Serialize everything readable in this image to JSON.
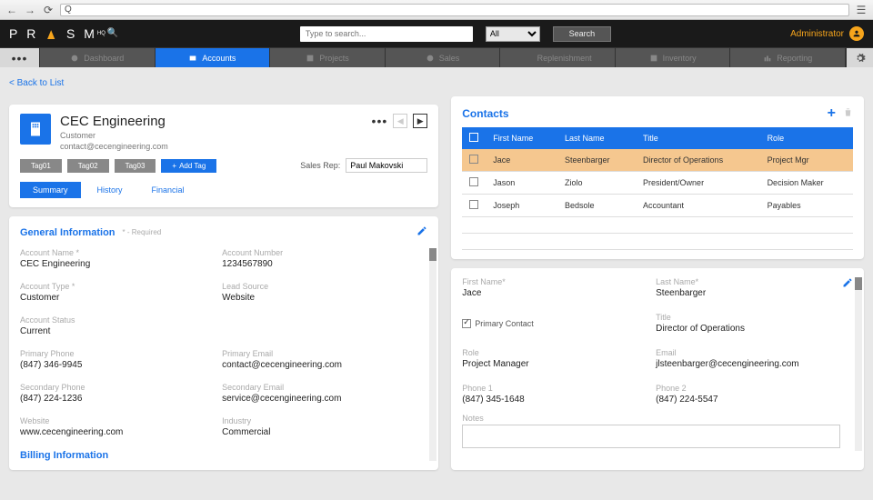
{
  "browser": {
    "url_prefix": "Q"
  },
  "header": {
    "logo": "P R   S M",
    "search_placeholder": "Type to search...",
    "filter": "All",
    "search_btn": "Search",
    "user": "Administrator"
  },
  "nav": {
    "items": [
      {
        "label": "Dashboard"
      },
      {
        "label": "Accounts"
      },
      {
        "label": "Projects"
      },
      {
        "label": "Sales"
      },
      {
        "label": "Replenishment"
      },
      {
        "label": "Inventory"
      },
      {
        "label": "Reporting"
      }
    ]
  },
  "back_link": "< Back to List",
  "account": {
    "name": "CEC Engineering",
    "type_line": "Customer",
    "email_line": "contact@cecengineering.com",
    "tags": [
      "Tag01",
      "Tag02",
      "Tag03"
    ],
    "add_tag": "Add Tag",
    "sales_rep_label": "Sales Rep:",
    "sales_rep": "Paul Makovski",
    "subtabs": [
      "Summary",
      "History",
      "Financial"
    ]
  },
  "general": {
    "title": "General Information",
    "required_note": "* - Required",
    "fields": {
      "acct_name_l": "Account Name *",
      "acct_name": "CEC Engineering",
      "acct_num_l": "Account Number",
      "acct_num": "1234567890",
      "acct_type_l": "Account Type *",
      "acct_type": "Customer",
      "lead_src_l": "Lead Source",
      "lead_src": "Website",
      "status_l": "Account Status",
      "status": "Current",
      "pphone_l": "Primary Phone",
      "pphone": "(847) 346-9945",
      "pemail_l": "Primary Email",
      "pemail": "contact@cecengineering.com",
      "sphone_l": "Secondary Phone",
      "sphone": "(847) 224-1236",
      "semail_l": "Secondary Email",
      "semail": "service@cecengineering.com",
      "web_l": "Website",
      "web": "www.cecengineering.com",
      "ind_l": "Industry",
      "ind": "Commercial"
    },
    "billing_title": "Billing Information"
  },
  "contacts": {
    "title": "Contacts",
    "cols": [
      "First Name",
      "Last Name",
      "Title",
      "Role"
    ],
    "rows": [
      {
        "fn": "Jace",
        "ln": "Steenbarger",
        "title": "Director of Operations",
        "role": "Project Mgr"
      },
      {
        "fn": "Jason",
        "ln": "Ziolo",
        "title": "President/Owner",
        "role": "Decision Maker"
      },
      {
        "fn": "Joseph",
        "ln": "Bedsole",
        "title": "Accountant",
        "role": "Payables"
      }
    ]
  },
  "contact_detail": {
    "fn_l": "First Name*",
    "fn": "Jace",
    "ln_l": "Last Name*",
    "ln": "Steenbarger",
    "primary": "Primary Contact",
    "title_l": "Title",
    "title": "Director of Operations",
    "role_l": "Role",
    "role": "Project Manager",
    "email_l": "Email",
    "email": "jlsteenbarger@cecengineering.com",
    "p1_l": "Phone 1",
    "p1": "(847) 345-1648",
    "p2_l": "Phone 2",
    "p2": "(847) 224-5547",
    "notes_l": "Notes"
  }
}
